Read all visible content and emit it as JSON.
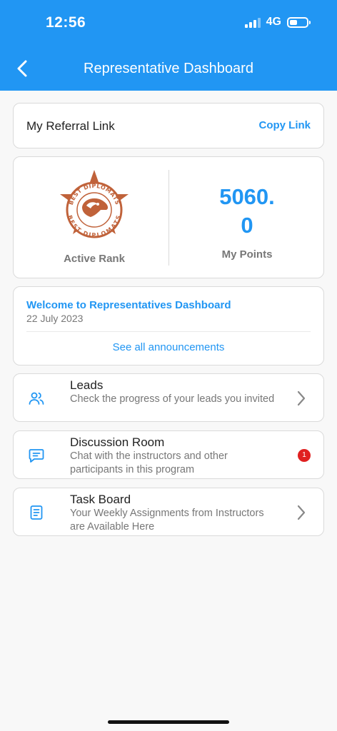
{
  "status_bar": {
    "time": "12:56",
    "network": "4G"
  },
  "header": {
    "title": "Representative Dashboard",
    "back_icon": "chevron-left-icon"
  },
  "referral": {
    "label": "My Referral Link",
    "action": "Copy Link"
  },
  "stats": {
    "rank_label": "Active Rank",
    "badge_text_top": "BEST DIPLOMATS",
    "badge_text_bottom": "BEST DIPLOMATS",
    "points_line1": "5060.",
    "points_line2": "0",
    "points_label": "My Points"
  },
  "announcement": {
    "title": "Welcome to Representatives Dashboard",
    "date": "22 July 2023",
    "link": "See all announcements"
  },
  "menu": [
    {
      "title": "Leads",
      "description": "Check the progress of your leads you invited",
      "icon": "users-icon",
      "trailing": "chevron-right-icon"
    },
    {
      "title": "Discussion Room",
      "description": "Chat with the instructors and other participants in this program",
      "icon": "chat-icon",
      "badge": "1"
    },
    {
      "title": "Task Board",
      "description": "Your Weekly Assignments from Instructors are Available Here",
      "icon": "document-icon",
      "trailing": "chevron-right-icon"
    }
  ],
  "colors": {
    "primary": "#2196f3",
    "badge_red": "#e02020",
    "emblem": "#c0623a"
  }
}
